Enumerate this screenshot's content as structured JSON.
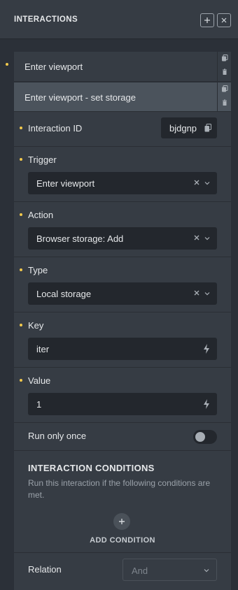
{
  "header": {
    "title": "INTERACTIONS",
    "add_icon": "plus-icon",
    "close_icon": "close-icon"
  },
  "interactions": [
    {
      "label": "Enter viewport"
    },
    {
      "label": "Enter viewport - set storage"
    }
  ],
  "form": {
    "interaction_id": {
      "label": "Interaction ID",
      "value": "bjdgnp"
    },
    "trigger": {
      "label": "Trigger",
      "value": "Enter viewport"
    },
    "action": {
      "label": "Action",
      "value": "Browser storage: Add"
    },
    "type": {
      "label": "Type",
      "value": "Local storage"
    },
    "key": {
      "label": "Key",
      "value": "iter"
    },
    "value": {
      "label": "Value",
      "value": "1"
    },
    "run_once": {
      "label": "Run only once",
      "enabled": false
    }
  },
  "conditions": {
    "title": "INTERACTION CONDITIONS",
    "description": "Run this interaction if the following conditions are met.",
    "add_label": "ADD CONDITION",
    "relation_label": "Relation",
    "relation_value": "And"
  },
  "colors": {
    "accent_dot": "#f2c94c",
    "panel": "#363c44",
    "input": "#23272d"
  }
}
